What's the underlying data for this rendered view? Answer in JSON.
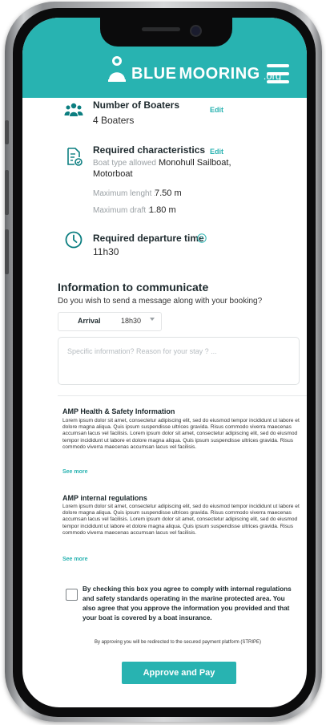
{
  "brand": {
    "blue": "BLUE",
    "mooring": "MOORING",
    "org": ".org",
    "accent_color": "#28b3b1"
  },
  "boaters": {
    "title": "Number of Boaters",
    "edit": "Edit",
    "value": "4 Boaters"
  },
  "characteristics": {
    "title": "Required characteristics",
    "edit": "Edit",
    "boat_type_label": "Boat type allowed :",
    "boat_type_value": "Monohull Sailboat,",
    "boat_type_value2": "Motorboat",
    "max_length_label": "Maximum lenght :",
    "max_length_value": "7.50 m",
    "max_draft_label": "Maximum draft :",
    "max_draft_value": "1.80 m"
  },
  "departure": {
    "title": "Required departure time",
    "value": "11h30"
  },
  "communicate": {
    "title": "Information to communicate",
    "question": "Do you wish to send a message along with your booking?",
    "select_label": "Arrival",
    "select_value": "18h30",
    "textarea_placeholder": "Specific information? Reason for your stay ? ..."
  },
  "health": {
    "title": "AMP Health & Safety Information",
    "body": "Lorem ipsum dolor sit amet, consectetur adipiscing elit, sed do eiusmod tempor incididunt ut labore et dolore magna aliqua. Quis ipsum suspendisse ultrices gravida. Risus commodo viverra maecenas accumsan lacus vel facilisis. Lorem ipsum dolor sit amet, consectetur adipiscing elit, sed do eiusmod tempor incididunt ut labore et dolore magna aliqua. Quis ipsum suspendisse ultrices gravida. Risus commodo viverra maecenas accumsan lacus vel facilisis.",
    "see_more": "See more"
  },
  "regulations": {
    "title": "AMP internal regulations",
    "body": "Lorem ipsum dolor sit amet, consectetur adipiscing elit, sed do eiusmod tempor incididunt ut labore et dolore magna aliqua. Quis ipsum suspendisse ultrices gravida. Risus commodo viverra maecenas accumsan lacus vel facilisis. Lorem ipsum dolor sit amet, consectetur adipiscing elit, sed do eiusmod tempor incididunt ut labore et dolore magna aliqua. Quis ipsum suspendisse ultrices gravida. Risus commodo viverra maecenas accumsan lacus vel facilisis.",
    "see_more": "See more"
  },
  "consent": {
    "text": "By checking this box you agree to comply with internal regulations and safety standards operating in the marine protected area. You also agree that you approve the information you provided and that your boat is covered by a boat insurance.",
    "checked": false
  },
  "payment": {
    "redirect_note": "By approving you will be redirected to the secured payment platform (STRIPE)",
    "button": "Approve and Pay"
  },
  "icons": {
    "boaters": "people-group-icon",
    "characteristics": "document-check-icon",
    "departure": "clock-icon",
    "help": "question-circle-icon",
    "menu": "hamburger-menu-icon",
    "logo": "mooring-buoy-icon",
    "dropdown": "chevron-down-icon"
  }
}
